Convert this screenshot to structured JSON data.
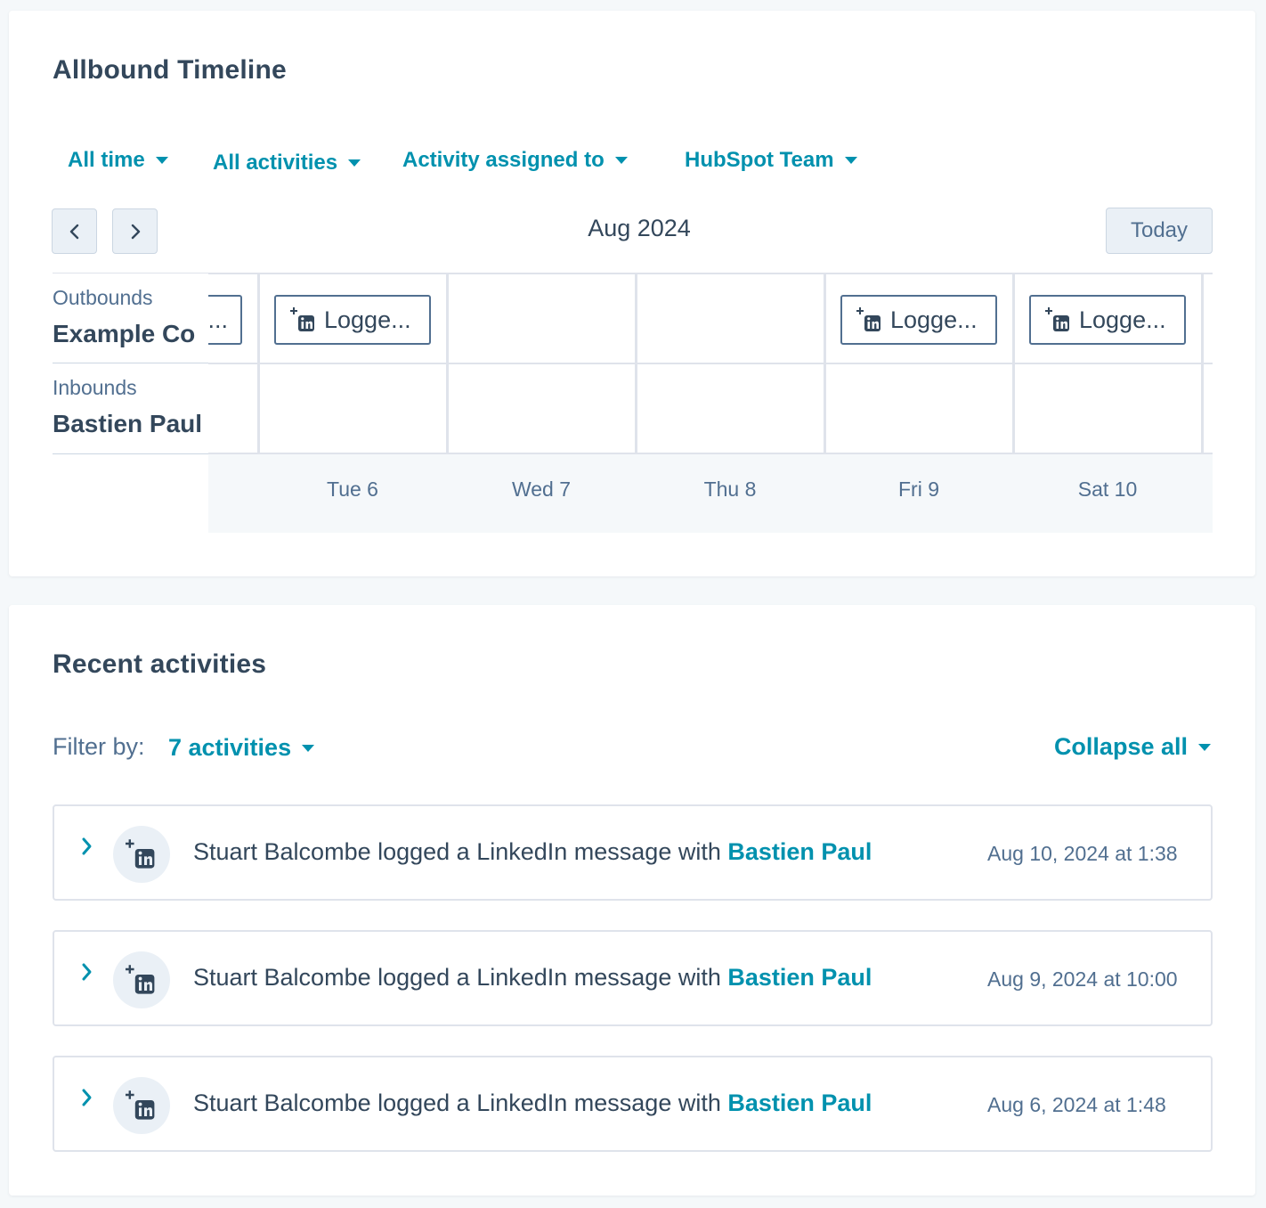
{
  "timeline": {
    "title": "Allbound Timeline",
    "filters": [
      {
        "label": "All time"
      },
      {
        "label": "All activities"
      },
      {
        "label": "Activity assigned to"
      },
      {
        "label": "HubSpot Team"
      }
    ],
    "month": "Aug 2024",
    "today_label": "Today",
    "rows": [
      {
        "type": "Outbounds",
        "name": "Example Co"
      },
      {
        "type": "Inbounds",
        "name": "Bastien Paul"
      }
    ],
    "days": [
      "Tue 6",
      "Wed 7",
      "Thu 8",
      "Fri 9",
      "Sat 10"
    ],
    "partial_chip_label": "...",
    "chip_label": "Logge..."
  },
  "activities": {
    "title": "Recent activities",
    "filter_by_label": "Filter by:",
    "filter_by_value": "7 activities",
    "collapse_all_label": "Collapse all",
    "items": [
      {
        "text": "Stuart Balcombe logged a LinkedIn message with ",
        "contact": "Bastien Paul",
        "timestamp": "Aug 10, 2024 at 1:38"
      },
      {
        "text": "Stuart Balcombe logged a LinkedIn message with ",
        "contact": "Bastien Paul",
        "timestamp": "Aug 9, 2024 at 10:00"
      },
      {
        "text": "Stuart Balcombe logged a LinkedIn message with ",
        "contact": "Bastien Paul",
        "timestamp": "Aug 6, 2024 at 1:48"
      }
    ]
  },
  "icons": {
    "linkedin_log": "linkedin-log-icon",
    "prev": "chevron-left-icon",
    "next": "chevron-right-icon",
    "expand": "chevron-right-icon",
    "dropdown": "caret-down-icon"
  },
  "colors": {
    "accent": "#0091ae",
    "text": "#33475b",
    "muted": "#516f90",
    "border": "#cbd6e2",
    "background": "#f5f8fa"
  }
}
